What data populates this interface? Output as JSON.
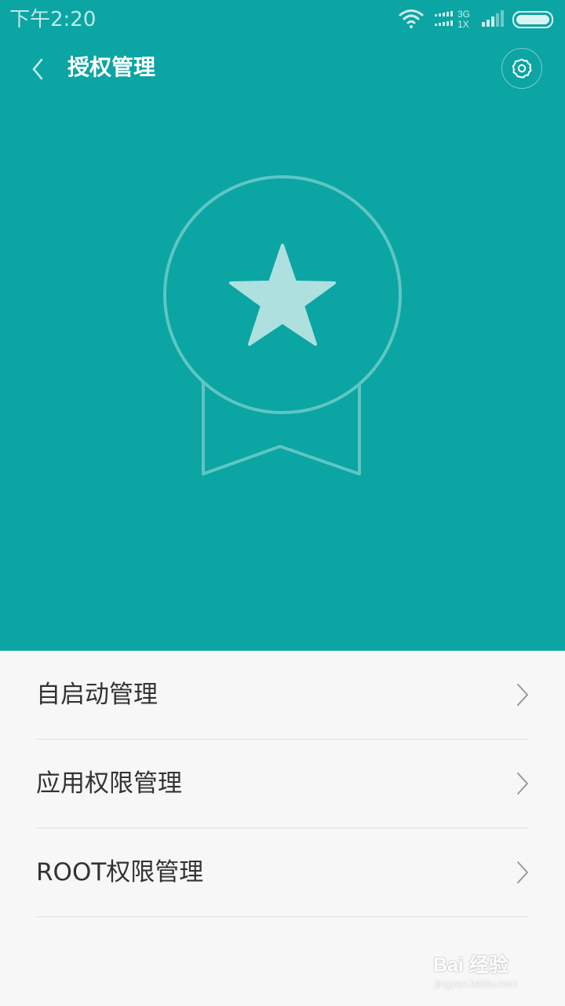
{
  "status_bar": {
    "time": "下午2:20",
    "network_type_top": "3G",
    "network_type_bottom": "1X",
    "icons": [
      "wifi-icon",
      "signal-dots-icon",
      "cell-signal-icon",
      "battery-icon"
    ]
  },
  "header": {
    "title": "授权管理",
    "back_icon": "chevron-left-icon",
    "settings_icon": "gear-icon"
  },
  "hero": {
    "icon": "medal-star-icon"
  },
  "menu": {
    "items": [
      {
        "label": "自启动管理",
        "icon": "chevron-right-icon"
      },
      {
        "label": "应用权限管理",
        "icon": "chevron-right-icon"
      },
      {
        "label": "ROOT权限管理",
        "icon": "chevron-right-icon"
      }
    ]
  },
  "watermark": {
    "main": "Bai 经验",
    "sub": "jingyan.baidu.com"
  },
  "colors": {
    "header_bg": "#0ba5a3",
    "star": "#aee0e0",
    "list_bg": "#f7f7f7"
  }
}
